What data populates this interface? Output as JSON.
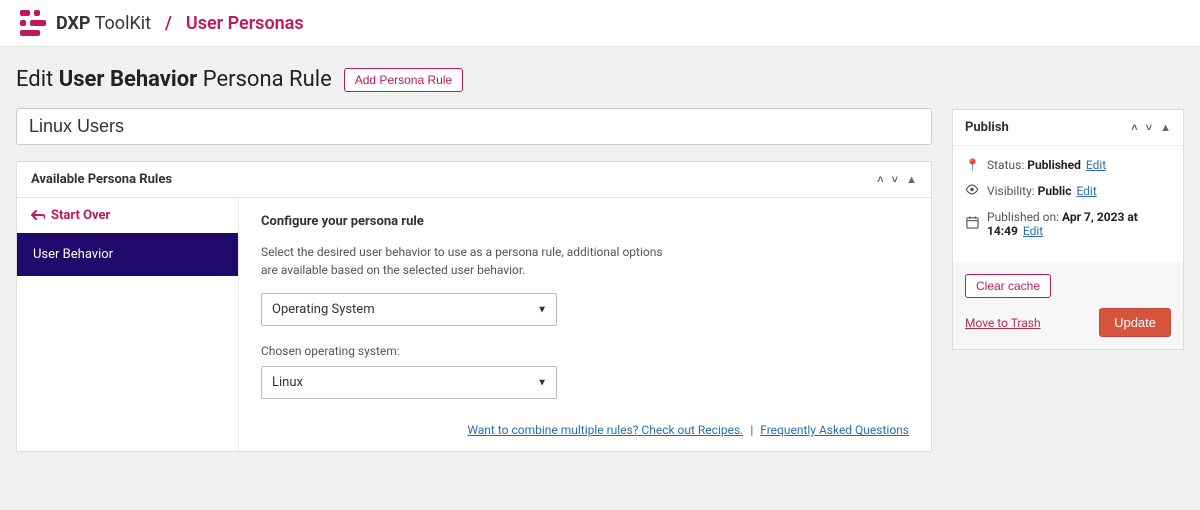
{
  "brand": {
    "bold": "DXP",
    "rest": "ToolKit"
  },
  "breadcrumb": {
    "current": "User Personas"
  },
  "page_title": {
    "prefix": "Edit",
    "bold": "User Behavior",
    "suffix": "Persona Rule"
  },
  "add_rule_btn": "Add Persona Rule",
  "title_value": "Linux Users",
  "panel": {
    "header": "Available Persona Rules",
    "start_over": "Start Over",
    "active_rule": "User Behavior",
    "config_title": "Configure your persona rule",
    "config_desc": "Select the desired user behavior to use as a persona rule, additional options are available based on the selected user behavior.",
    "behavior_select": "Operating System",
    "os_label": "Chosen operating system:",
    "os_select": "Linux",
    "help_combine": "Want to combine multiple rules? Check out Recipes.",
    "help_faq": "Frequently Asked Questions"
  },
  "publish": {
    "header": "Publish",
    "status_label": "Status:",
    "status_value": "Published",
    "visibility_label": "Visibility:",
    "visibility_value": "Public",
    "published_label": "Published on:",
    "published_value": "Apr 7, 2023 at 14:49",
    "edit": "Edit",
    "clear_cache": "Clear cache",
    "trash": "Move to Trash",
    "update": "Update"
  }
}
